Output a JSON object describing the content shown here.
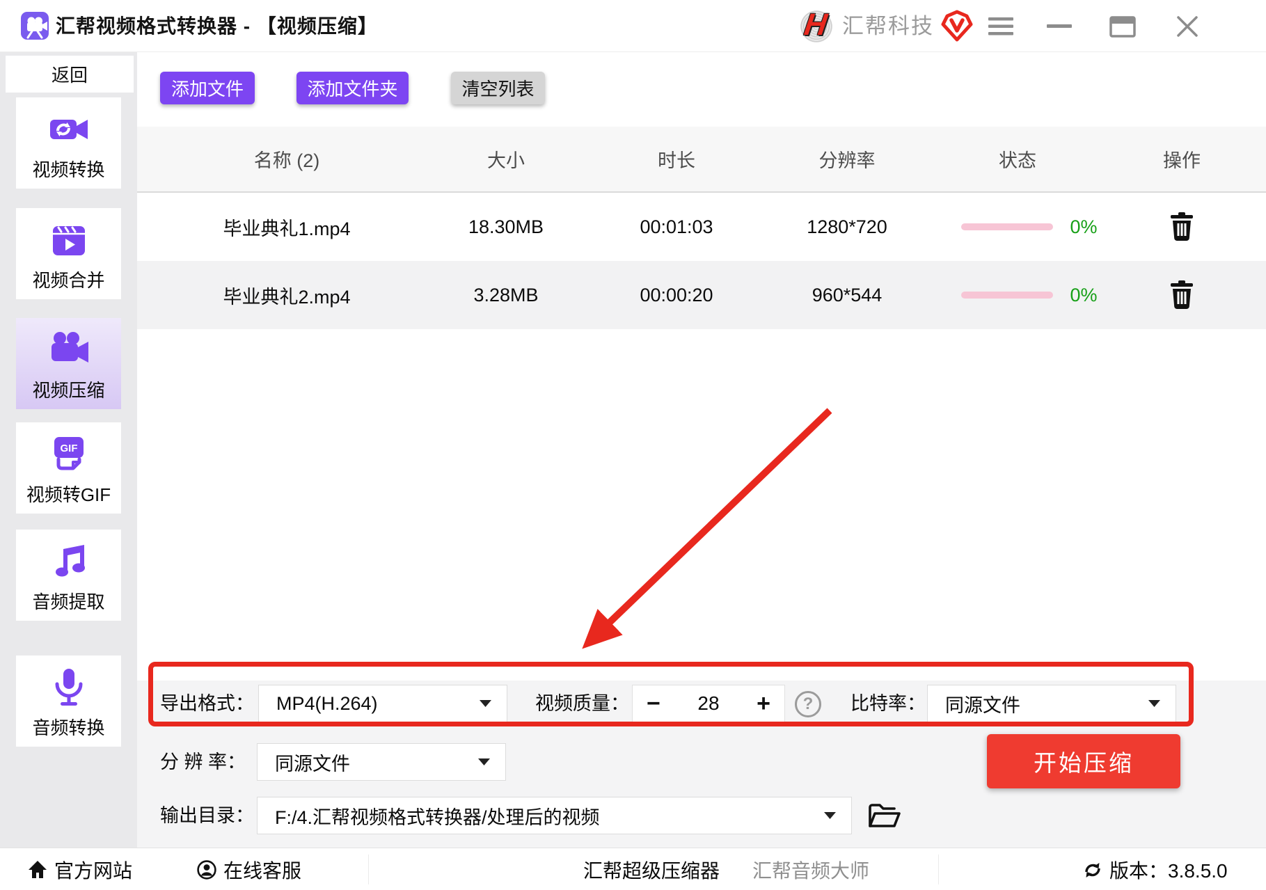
{
  "titlebar": {
    "app_title": "汇帮视频格式转换器 - 【视频压缩】",
    "brand": "汇帮科技"
  },
  "sidebar": {
    "back": "返回",
    "items": [
      {
        "icon": "video-convert-icon",
        "label": "视频转换",
        "active": false
      },
      {
        "icon": "video-merge-icon",
        "label": "视频合并",
        "active": false
      },
      {
        "icon": "video-compress-icon",
        "label": "视频压缩",
        "active": true
      },
      {
        "icon": "video-gif-icon",
        "label": "视频转GIF",
        "active": false,
        "icon_text": "GIF"
      },
      {
        "icon": "audio-extract-icon",
        "label": "音频提取",
        "active": false
      },
      {
        "icon": "audio-convert-icon",
        "label": "音频转换",
        "active": false
      }
    ]
  },
  "toolbar": {
    "add_file": "添加文件",
    "add_folder": "添加文件夹",
    "clear_list": "清空列表"
  },
  "table": {
    "headers": [
      "名称 (2)",
      "大小",
      "时长",
      "分辨率",
      "状态",
      "操作"
    ],
    "rows": [
      {
        "name": "毕业典礼1.mp4",
        "size": "18.30MB",
        "duration": "00:01:03",
        "resolution": "1280*720",
        "progress": "0%"
      },
      {
        "name": "毕业典礼2.mp4",
        "size": "3.28MB",
        "duration": "00:00:20",
        "resolution": "960*544",
        "progress": "0%"
      }
    ]
  },
  "settings": {
    "export_format_label": "导出格式：",
    "export_format_value": "MP4(H.264)",
    "video_quality_label": "视频质量：",
    "video_quality_value": "28",
    "minus": "−",
    "plus": "+",
    "help": "?",
    "bitrate_label": "比特率：",
    "bitrate_value": "同源文件",
    "resolution_label": "分 辨 率：",
    "resolution_value": "同源文件",
    "output_dir_label": "输出目录：",
    "output_dir_value": "F:/4.汇帮视频格式转换器/处理后的视频",
    "start_button": "开始压缩"
  },
  "footer": {
    "official_site": "官方网站",
    "online_service": "在线客服",
    "super_compressor": "汇帮超级压缩器",
    "audio_master": "汇帮音频大师",
    "version": "版本：3.8.5.0"
  },
  "colors": {
    "accent": "#7d45f2",
    "danger": "#e8281e",
    "start_red": "#ef3b30",
    "progress_pink": "#f7c5d5",
    "percent_green": "#18a018",
    "sidebar_icon": "#7b46f0"
  }
}
